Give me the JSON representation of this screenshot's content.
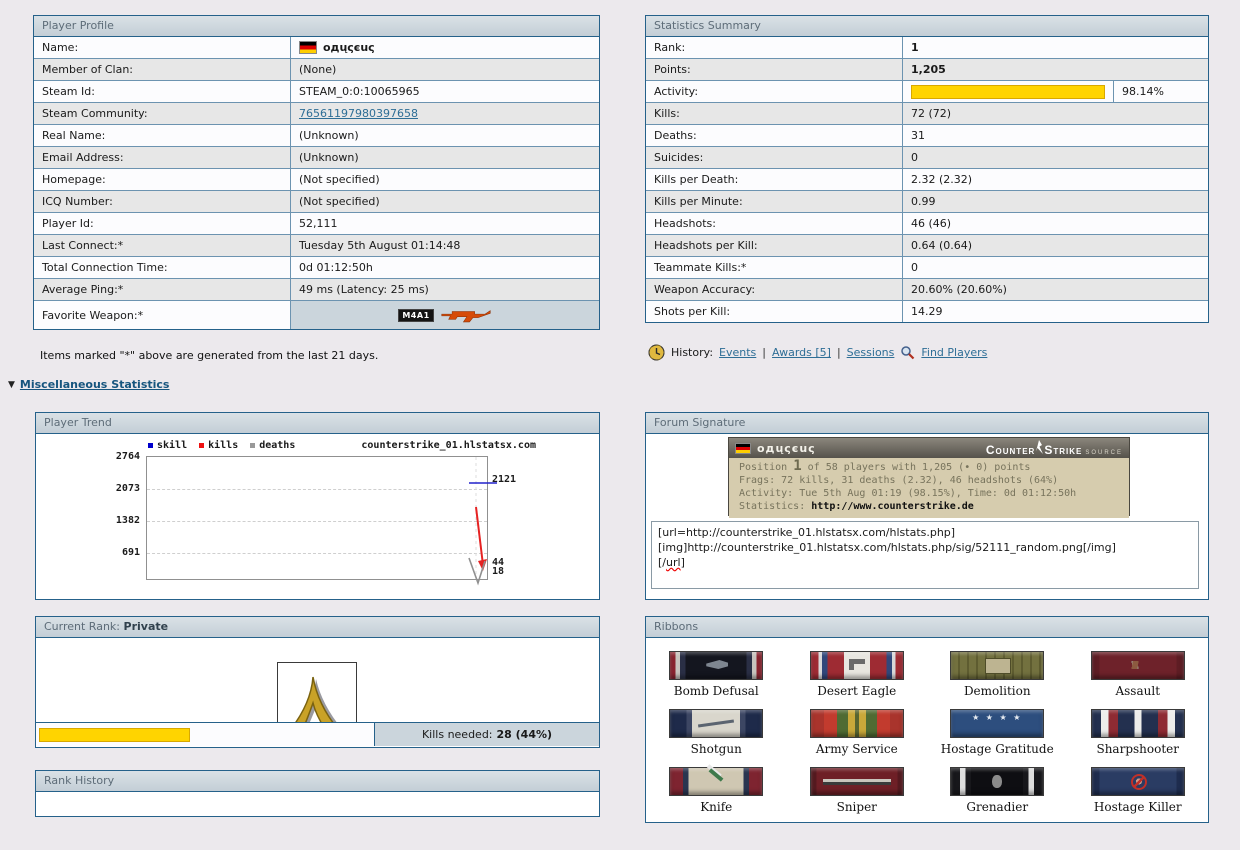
{
  "colors": {
    "accent_yellow": "#FFD400",
    "panel_border": "#25618A",
    "link_blue": "#2E6E96"
  },
  "profile": {
    "title": "Player Profile",
    "rows": [
      {
        "label": "Name:",
        "value": "oдųςєuς"
      },
      {
        "label": "Member of Clan:",
        "value": "(None)"
      },
      {
        "label": "Steam Id:",
        "value": "STEAM_0:0:10065965"
      },
      {
        "label": "Steam Community:",
        "value": "76561197980397658"
      },
      {
        "label": "Real Name:",
        "value": "(Unknown)"
      },
      {
        "label": "Email Address:",
        "value": "(Unknown)"
      },
      {
        "label": "Homepage:",
        "value": "(Not specified)"
      },
      {
        "label": "ICQ Number:",
        "value": "(Not specified)"
      },
      {
        "label": "Player Id:",
        "value": "52,111"
      },
      {
        "label": "Last Connect:*",
        "value": "Tuesday 5th August 01:14:48"
      },
      {
        "label": "Total Connection Time:",
        "value": "0d 01:12:50h"
      },
      {
        "label": "Average Ping:*",
        "value": "49 ms (Latency: 25 ms)"
      },
      {
        "label": "Favorite Weapon:*",
        "value": "M4A1"
      }
    ]
  },
  "profile_note": "Items marked \"*\" above are generated from the last 21 days.",
  "stats": {
    "title": "Statistics Summary",
    "rows": [
      {
        "label": "Rank:",
        "value": "1"
      },
      {
        "label": "Points:",
        "value": "1,205"
      },
      {
        "label": "Activity:",
        "value": "98.14%"
      },
      {
        "label": "Kills:",
        "value": "72 (72)"
      },
      {
        "label": "Deaths:",
        "value": "31"
      },
      {
        "label": "Suicides:",
        "value": "0"
      },
      {
        "label": "Kills per Death:",
        "value": "2.32 (2.32)"
      },
      {
        "label": "Kills per Minute:",
        "value": "0.99"
      },
      {
        "label": "Headshots:",
        "value": "46 (46)"
      },
      {
        "label": "Headshots per Kill:",
        "value": "0.64 (0.64)"
      },
      {
        "label": "Teammate Kills:*",
        "value": "0"
      },
      {
        "label": "Weapon Accuracy:",
        "value": "20.60% (20.60%)"
      },
      {
        "label": "Shots per Kill:",
        "value": "14.29"
      }
    ],
    "activity_bar_style": "width:98.14%"
  },
  "history": {
    "label": "History:",
    "link1": "Events",
    "link2": "Awards [5]",
    "link3": "Sessions",
    "find": "Find Players"
  },
  "misc_link": "Miscellaneous Statistics",
  "trend": {
    "title": "Player Trend"
  },
  "chart_data": {
    "type": "line",
    "title": "counterstrike_01.hlstatsx.com",
    "legend": [
      {
        "name": "skill",
        "color": "#0000CC"
      },
      {
        "name": "kills",
        "color": "#EE1111"
      },
      {
        "name": "deaths",
        "color": "#999999"
      }
    ],
    "yticks": [
      2764,
      2073,
      1382,
      691
    ],
    "ylim": [
      0,
      2764
    ],
    "grid": "dashed horizontal at yticks, dashed vertical at latest sample",
    "legend_position": "top-left",
    "series": [
      {
        "name": "skill",
        "values": [
          2121,
          2121
        ],
        "end_label": 2121
      },
      {
        "name": "kills",
        "values": [
          1650,
          44
        ],
        "end_label": 44
      },
      {
        "name": "deaths",
        "values": [
          650,
          18
        ],
        "end_label": 18
      }
    ],
    "x_note": "data only at right edge (most recent day)"
  },
  "signature": {
    "title": "Forum Signature",
    "name": "oдųςєuς",
    "logo_counter": "Counter",
    "logo_strike": "Strike",
    "logo_sub": "SOURCE",
    "line1_pre": "Position",
    "line1_big": "1",
    "line1_post": "of 58 players with 1,205 (• 0) points",
    "line2": "Frags: 72 kills, 31 deaths (2.32), 46 headshots (64%)",
    "line3": "Activity: Tue 5th Aug 01:19 (98.15%), Time: 0d 01:12:50h",
    "line4_label": "Statistics:",
    "line4_url": "http://www.counterstrike.de"
  },
  "sig_code": {
    "line1": "[url=http://counterstrike_01.hlstatsx.com/hlstats.php]",
    "line2": "[img]http://counterstrike_01.hlstatsx.com/hlstats.php/sig/52111_random.png[/img]",
    "line3_open": "[/",
    "line3_word": "url",
    "line3_close": "]"
  },
  "current_rank": {
    "title_label": "Current Rank:",
    "rank": "Private",
    "kills_needed_label": "Kills needed:",
    "kills_needed_value": "28 (44%)",
    "progress_style": "width:44%"
  },
  "rank_history": {
    "title": "Rank History"
  },
  "ribbons": {
    "title": "Ribbons",
    "items": [
      "Bomb Defusal",
      "Desert Eagle",
      "Demolition",
      "Assault",
      "Shotgun",
      "Army Service",
      "Hostage Gratitude",
      "Sharpshooter",
      "Knife",
      "Sniper",
      "Grenadier",
      "Hostage Killer"
    ]
  }
}
